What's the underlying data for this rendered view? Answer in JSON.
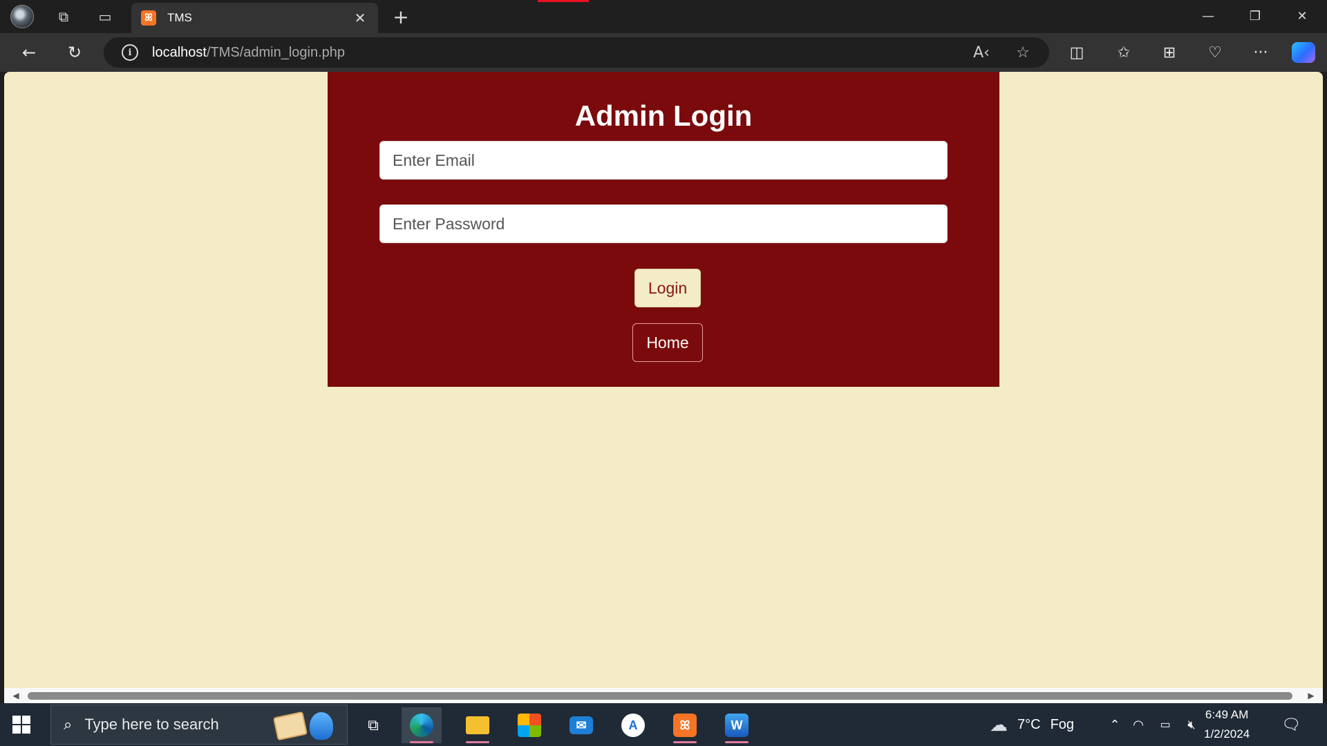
{
  "browser": {
    "tab": {
      "title": "TMS"
    },
    "url": {
      "host": "localhost",
      "path": "/TMS/admin_login.php"
    }
  },
  "page": {
    "title": "Admin Login",
    "email_placeholder": "Enter Email",
    "password_placeholder": "Enter Password",
    "login_label": "Login",
    "home_label": "Home"
  },
  "taskbar": {
    "search_placeholder": "Type here to search",
    "weather": {
      "temp": "7°C",
      "condition": "Fog"
    },
    "clock": {
      "time": "6:49 AM",
      "date": "1/2/2024"
    }
  },
  "colors": {
    "page_bg": "#f3ecc7",
    "panel_bg": "#7b0a0c",
    "browser_dark": "#1f1f1f",
    "taskbar_bg": "#202a36"
  }
}
